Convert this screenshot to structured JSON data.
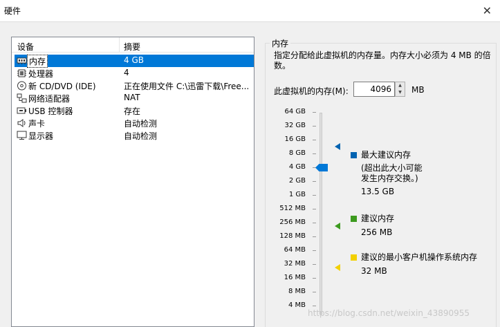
{
  "window": {
    "title": "硬件",
    "close_symbol": "✕"
  },
  "device_list": {
    "headers": {
      "device": "设备",
      "summary": "摘要"
    },
    "items": [
      {
        "name": "内存",
        "summary": "4 GB",
        "icon": "memory-icon"
      },
      {
        "name": "处理器",
        "summary": "4",
        "icon": "processor-icon"
      },
      {
        "name": "新 CD/DVD (IDE)",
        "summary": "正在使用文件 C:\\迅雷下载\\Free...",
        "icon": "cd-dvd-icon"
      },
      {
        "name": "网络适配器",
        "summary": "NAT",
        "icon": "network-adapter-icon"
      },
      {
        "name": "USB 控制器",
        "summary": "存在",
        "icon": "usb-controller-icon"
      },
      {
        "name": "声卡",
        "summary": "自动检测",
        "icon": "sound-card-icon"
      },
      {
        "name": "显示器",
        "summary": "自动检测",
        "icon": "display-icon"
      }
    ]
  },
  "memory": {
    "group_title": "内存",
    "description": "指定分配给此虚拟机的内存量。内存大小必须为 4 MB 的倍数。",
    "input_label": "此虚拟机的内存(M):",
    "value": "4096",
    "unit": "MB",
    "scale": [
      "64 GB",
      "32 GB",
      "16 GB",
      "8 GB",
      "4 GB",
      "2 GB",
      "1 GB",
      "512 MB",
      "256 MB",
      "128 MB",
      "64 MB",
      "32 MB",
      "16 MB",
      "8 MB",
      "4 MB"
    ],
    "selected_level": "4 GB",
    "legend": {
      "max": {
        "title": "最大建议内存",
        "note_line1": "(超出此大小可能",
        "note_line2": "发生内存交换。)",
        "value": "13.5 GB",
        "color": "#0063b1"
      },
      "recommended": {
        "title": "建议内存",
        "value": "256 MB",
        "color": "#3c9a1e"
      },
      "guest_min": {
        "title": "建议的最小客户机操作系统内存",
        "value": "32 MB",
        "color": "#f2d000"
      }
    },
    "thumb_color": "#0078d7"
  },
  "watermark": "https://blog.csdn.net/weixin_43890955"
}
